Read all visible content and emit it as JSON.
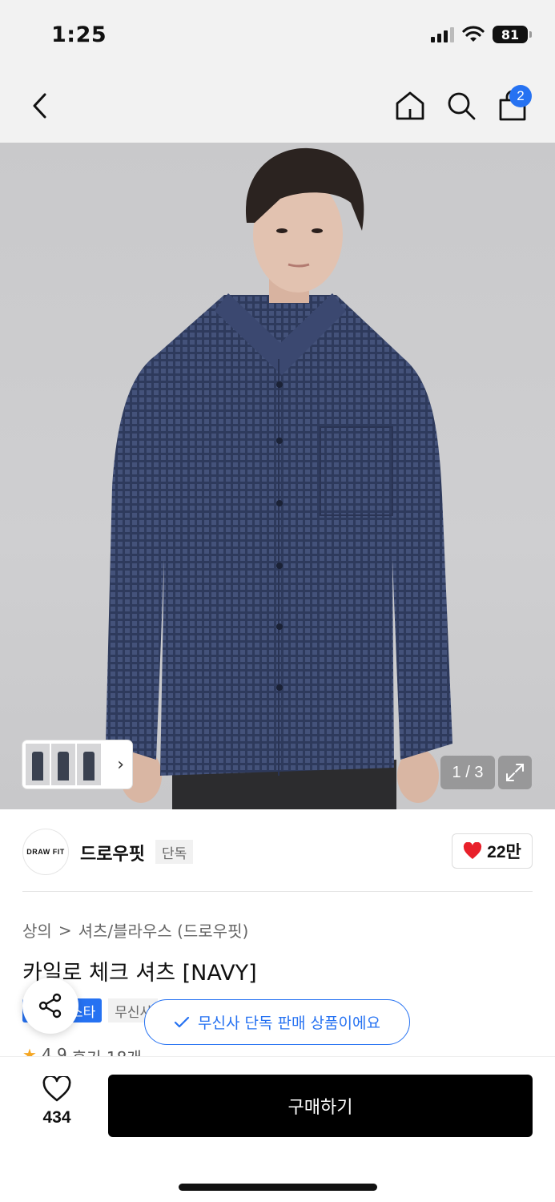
{
  "status": {
    "time": "1:25",
    "battery": "81"
  },
  "nav": {
    "cart_count": "2"
  },
  "gallery": {
    "counter": "1 / 3"
  },
  "brand": {
    "logo_text": "DRAW FIT",
    "name": "드로우핏",
    "tag": "단독",
    "likes": "22만"
  },
  "breadcrumb": {
    "category": "상의",
    "separator": ">",
    "subcategory": "셔츠/블라우스 (드로우핏)"
  },
  "product": {
    "title": "카일로 체크 셔츠 [NAVY]",
    "tag_blue": "스타",
    "tag_gray": "무신사",
    "exclusive_notice": "무신사 단독 판매 상품이에요",
    "rating": "4.9",
    "reviews": "후기 18개"
  },
  "bottom": {
    "wish_count": "434",
    "buy_label": "구매하기"
  },
  "colors": {
    "accent": "#2672f2",
    "buy_button": "#000000",
    "heart": "#e8202a"
  }
}
